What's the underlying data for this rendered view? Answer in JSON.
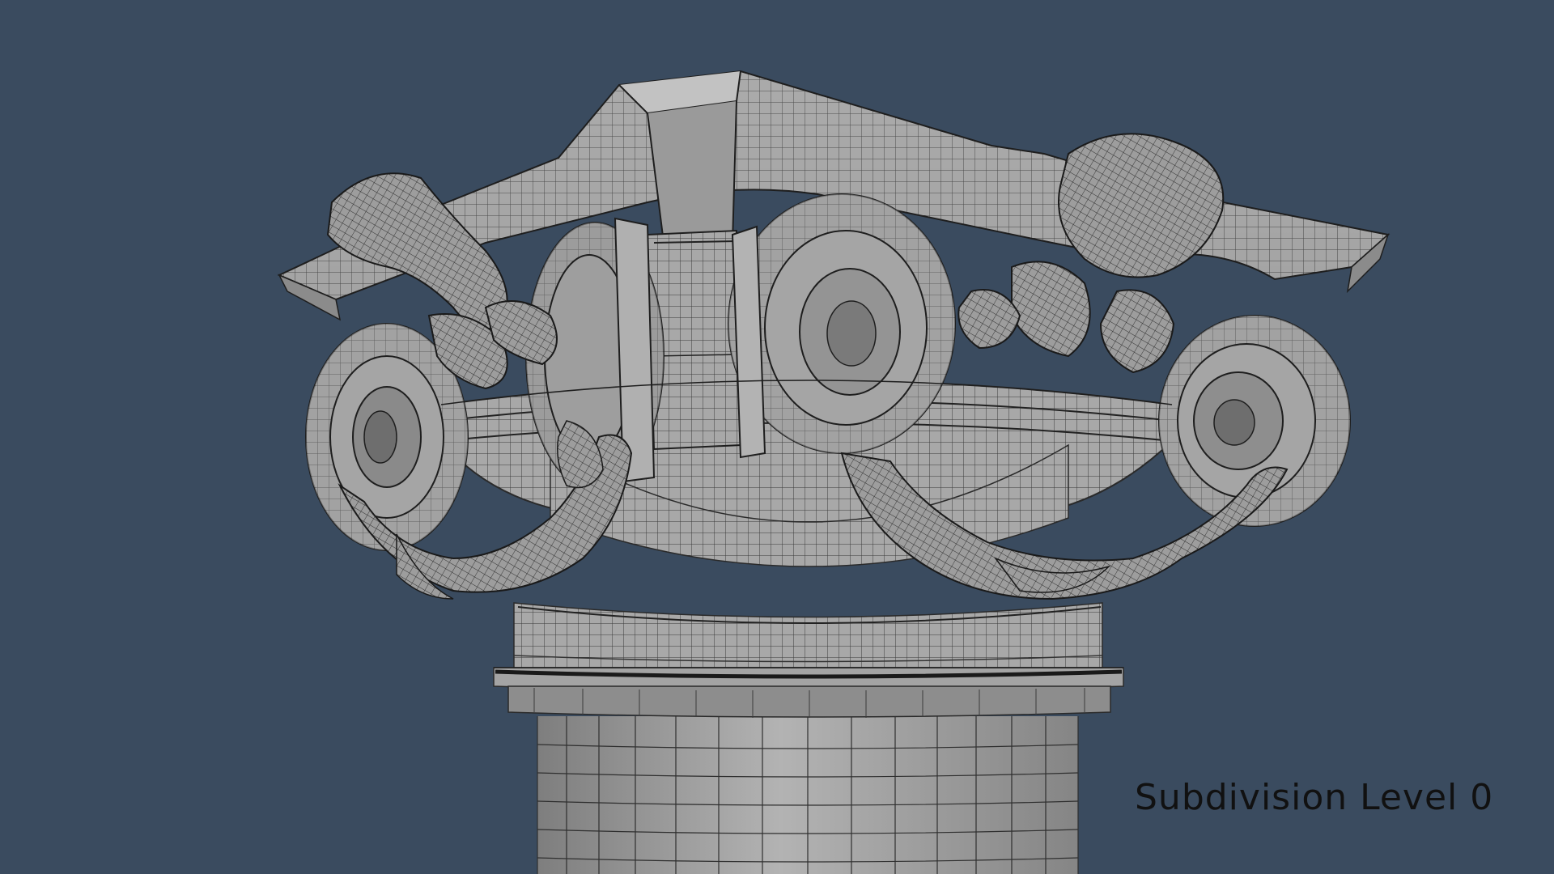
{
  "viewport": {
    "background_color": "#3a4b5f",
    "mesh_color": "#a9a9a9",
    "wire_color": "#2a2a2a",
    "subject": "column-capital-wireframe"
  },
  "overlay": {
    "subdivision_label": "Subdivision Level 0"
  }
}
